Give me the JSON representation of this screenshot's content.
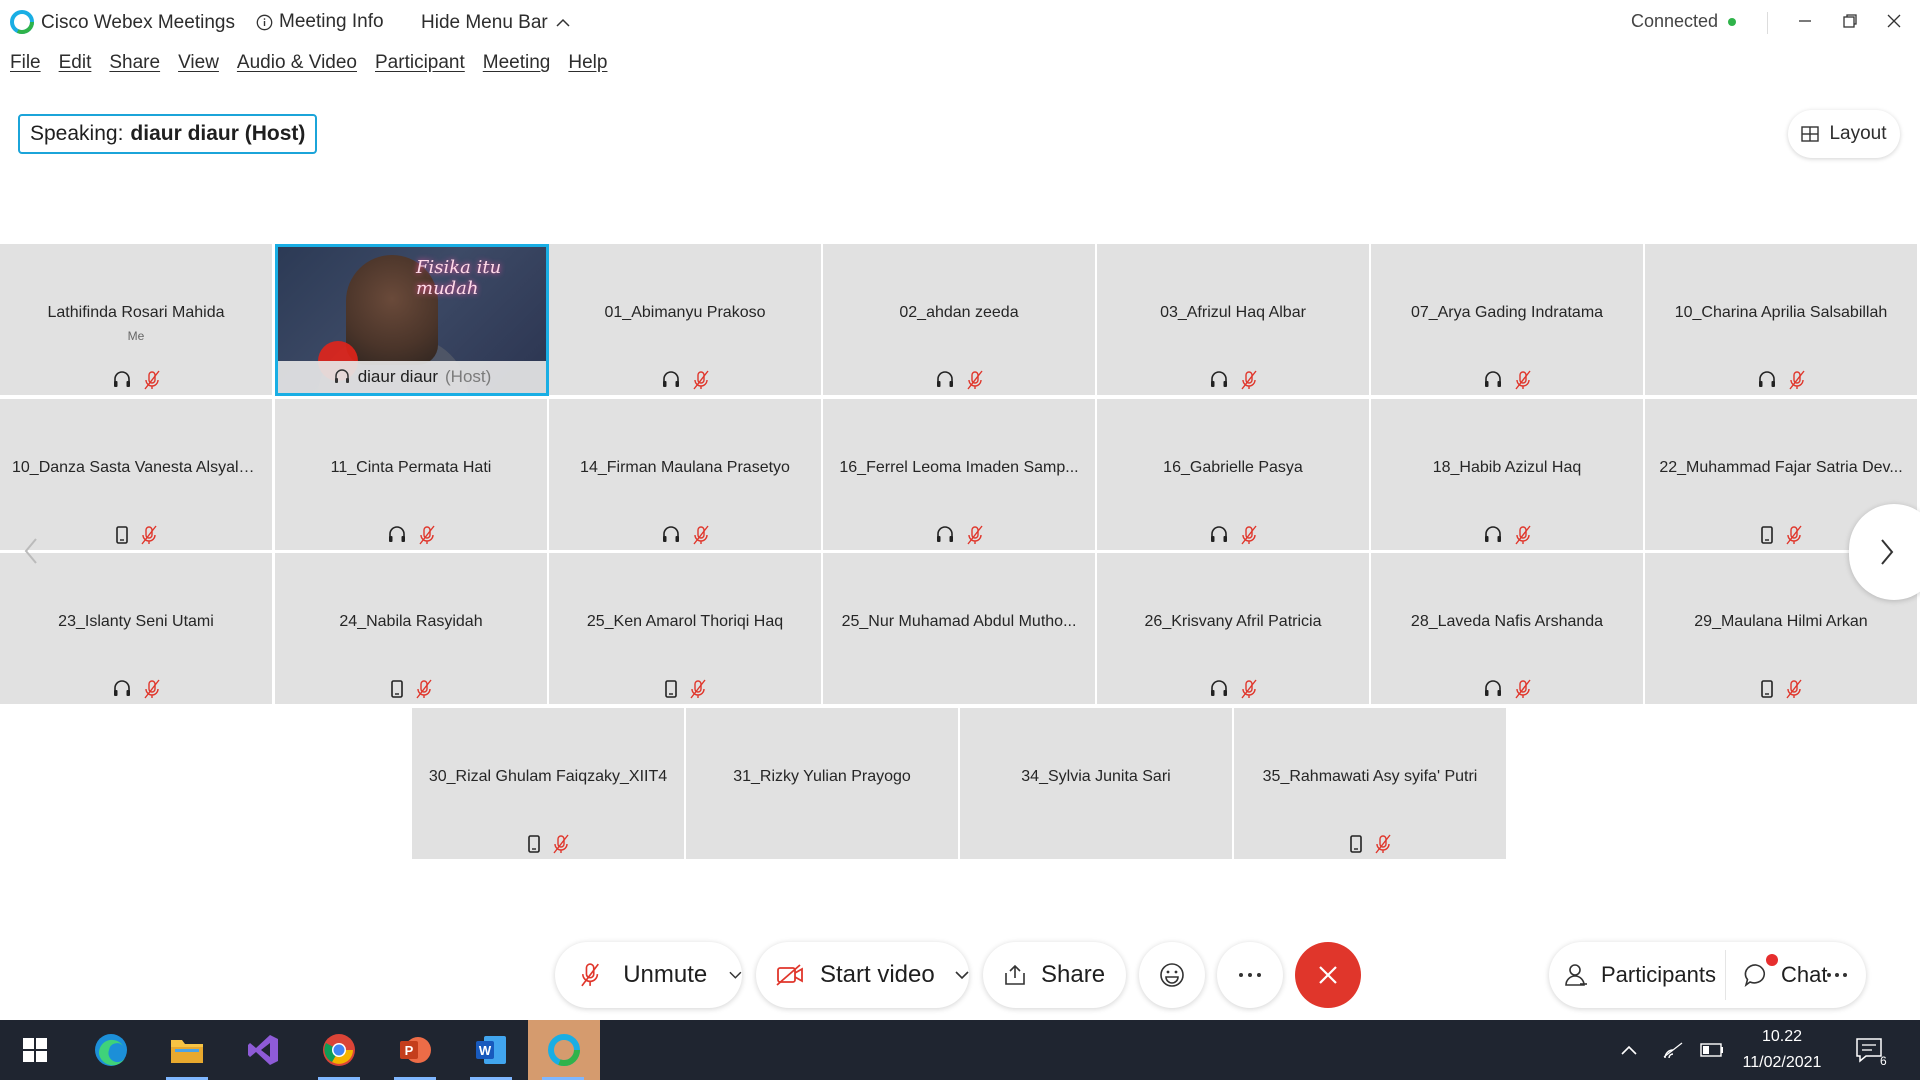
{
  "titlebar": {
    "app_title": "Cisco Webex Meetings",
    "meeting_info": "Meeting Info",
    "hide_menu": "Hide Menu Bar",
    "status": "Connected"
  },
  "menu": [
    "File",
    "Edit",
    "Share",
    "View",
    "Audio & Video",
    "Participant",
    "Meeting",
    "Help"
  ],
  "speaking": {
    "label": "Speaking:",
    "name": "diaur diaur (Host)"
  },
  "layout_button": "Layout",
  "video_tile": {
    "name": "diaur diaur",
    "role": "(Host)",
    "art_text": "Fisika itu mudah"
  },
  "participants": [
    {
      "name": "Lathifinda Rosari Mahida",
      "sub": "Me",
      "device": "headset",
      "muted": true
    },
    {
      "name": "01_Abimanyu Prakoso",
      "device": "headset",
      "muted": true
    },
    {
      "name": "02_ahdan zeeda",
      "device": "headset",
      "muted": true
    },
    {
      "name": "03_Afrizul Haq Albar",
      "device": "headset",
      "muted": true
    },
    {
      "name": "07_Arya Gading Indratama",
      "device": "headset",
      "muted": true
    },
    {
      "name": "10_Charina Aprilia Salsabillah",
      "device": "headset",
      "muted": true
    },
    {
      "name": "10_Danza Sasta Vanesta Alsyalu...",
      "device": "phone",
      "muted": true
    },
    {
      "name": "11_Cinta Permata Hati",
      "device": "headset",
      "muted": true
    },
    {
      "name": "14_Firman Maulana Prasetyo",
      "device": "headset",
      "muted": true
    },
    {
      "name": "16_Ferrel Leoma Imaden Samp...",
      "device": "headset",
      "muted": true
    },
    {
      "name": "16_Gabrielle Pasya",
      "device": "headset",
      "muted": true
    },
    {
      "name": "18_Habib Azizul Haq",
      "device": "headset",
      "muted": true
    },
    {
      "name": "22_Muhammad Fajar Satria Dev...",
      "device": "phone",
      "muted": true
    },
    {
      "name": "23_Islanty Seni Utami",
      "device": "headset",
      "muted": true
    },
    {
      "name": "24_Nabila Rasyidah",
      "device": "phone",
      "muted": true
    },
    {
      "name": "25_Ken Amarol Thoriqi Haq",
      "device": "phone",
      "muted": true
    },
    {
      "name": "25_Nur Muhamad Abdul Mutho...",
      "device": "none",
      "muted": false
    },
    {
      "name": "26_Krisvany Afril Patricia",
      "device": "headset",
      "muted": true
    },
    {
      "name": "28_Laveda Nafis Arshanda",
      "device": "headset",
      "muted": true
    },
    {
      "name": "29_Maulana Hilmi Arkan",
      "device": "phone",
      "muted": true
    },
    {
      "name": "30_Rizal Ghulam Faiqzaky_XIIT4",
      "device": "phone",
      "muted": true
    },
    {
      "name": "31_Rizky Yulian Prayogo",
      "device": "none",
      "muted": false
    },
    {
      "name": "34_Sylvia Junita Sari",
      "device": "none",
      "muted": false
    },
    {
      "name": "35_Rahmawati Asy syifa' Putri",
      "device": "phone",
      "muted": true
    }
  ],
  "controls": {
    "unmute": "Unmute",
    "start_video": "Start video",
    "share": "Share",
    "participants": "Participants",
    "chat": "Chat"
  },
  "taskbar": {
    "time": "10.22",
    "date": "11/02/2021",
    "notifications": "6"
  },
  "colors": {
    "accent": "#19aee4",
    "end": "#e0362b",
    "muted": "#e0362b",
    "connected": "#2fb34a"
  }
}
